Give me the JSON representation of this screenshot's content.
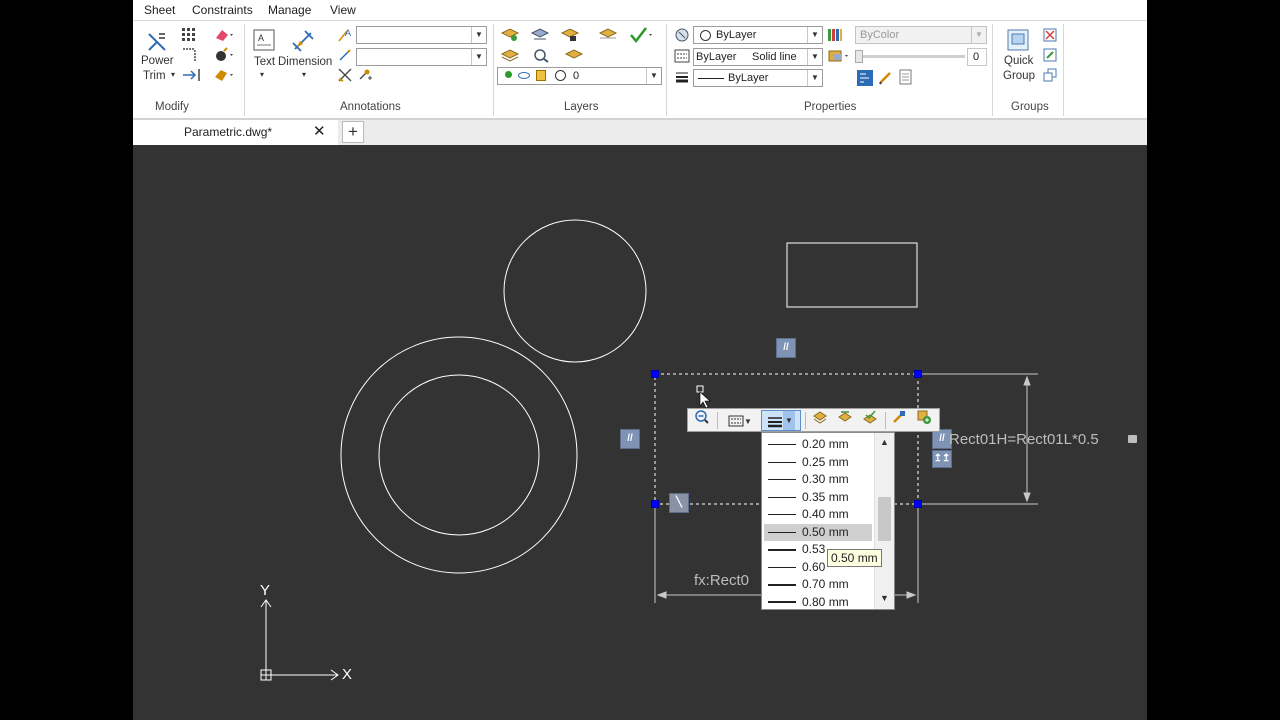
{
  "menu": [
    "Sheet",
    "Constraints",
    "Manage",
    "View"
  ],
  "modify": {
    "power_trim_line1": "Power",
    "power_trim_line2": "Trim",
    "group_label": "Modify"
  },
  "annotations": {
    "text_label": "Text",
    "dimension_label": "Dimension",
    "group_label": "Annotations"
  },
  "layers": {
    "current_layer": "0",
    "group_label": "Layers"
  },
  "properties": {
    "color": "ByLayer",
    "linetype_layer": "ByLayer",
    "linetype_name": "Solid line",
    "lineweight": "ByLayer",
    "plotstyle": "ByColor",
    "transparency": "0",
    "group_label": "Properties"
  },
  "groups": {
    "quick_group_line1": "Quick",
    "quick_group_line2": "Group",
    "group_label": "Groups"
  },
  "document": {
    "tab_name": "Parametric.dwg*"
  },
  "canvas": {
    "constraint_text": "Rect01H=Rect01L*0.5",
    "formula_text": "fx:Rect0",
    "ucs_x": "X",
    "ucs_y": "Y"
  },
  "lineweight_dropdown": {
    "items": [
      "0.20 mm",
      "0.25 mm",
      "0.30 mm",
      "0.35 mm",
      "0.40 mm",
      "0.50 mm",
      "0.53",
      "0.60",
      "0.70 mm",
      "0.80 mm"
    ],
    "selected": "0.50 mm",
    "tooltip": "0.50 mm"
  },
  "colors": {
    "canvas_bg": "#333333",
    "grip": "#0000ff",
    "geometry": "#ffffff",
    "accent": "#7f93b5"
  }
}
